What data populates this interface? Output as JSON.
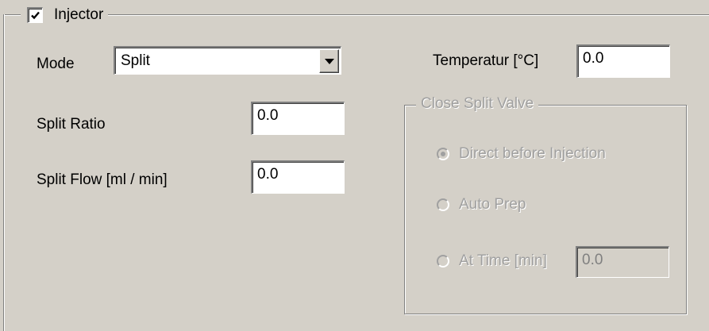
{
  "injector": {
    "title": "Injector",
    "enabled": true,
    "mode": {
      "label": "Mode",
      "value": "Split"
    },
    "split_ratio": {
      "label": "Split Ratio",
      "value": "0.0"
    },
    "split_flow": {
      "label": "Split Flow [ml / min]",
      "value": "0.0"
    },
    "temperature": {
      "label": "Temperatur [°C]",
      "value": "0.0"
    },
    "close_split_valve": {
      "title": "Close Split Valve",
      "options": [
        {
          "label": "Direct before Injection",
          "selected": true
        },
        {
          "label": "Auto Prep",
          "selected": false
        },
        {
          "label": "At Time [min]",
          "selected": false
        }
      ],
      "at_time_value": "0.0"
    }
  }
}
